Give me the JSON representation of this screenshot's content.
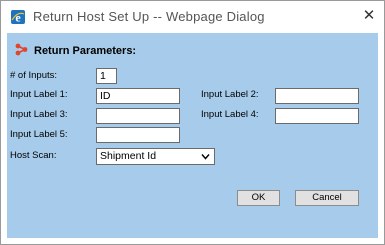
{
  "window": {
    "title": "Return Host Set Up -- Webpage Dialog",
    "close_glyph": "✕"
  },
  "section": {
    "title": "Return Parameters:",
    "icon": "share-nodes-icon",
    "icon_color": "#e0462b"
  },
  "form": {
    "num_inputs_label": "# of Inputs:",
    "num_inputs_value": "1",
    "input_label_1_label": "Input Label 1:",
    "input_label_1_value": "ID",
    "input_label_2_label": "Input Label 2:",
    "input_label_2_value": "",
    "input_label_3_label": "Input Label 3:",
    "input_label_3_value": "",
    "input_label_4_label": "Input Label 4:",
    "input_label_4_value": "",
    "input_label_5_label": "Input Label 5:",
    "input_label_5_value": "",
    "host_scan_label": "Host Scan:",
    "host_scan_selected": "Shipment Id"
  },
  "buttons": {
    "ok": "OK",
    "cancel": "Cancel"
  },
  "colors": {
    "panel_bg": "#a7cceb",
    "ie_icon": "#1e73be"
  }
}
